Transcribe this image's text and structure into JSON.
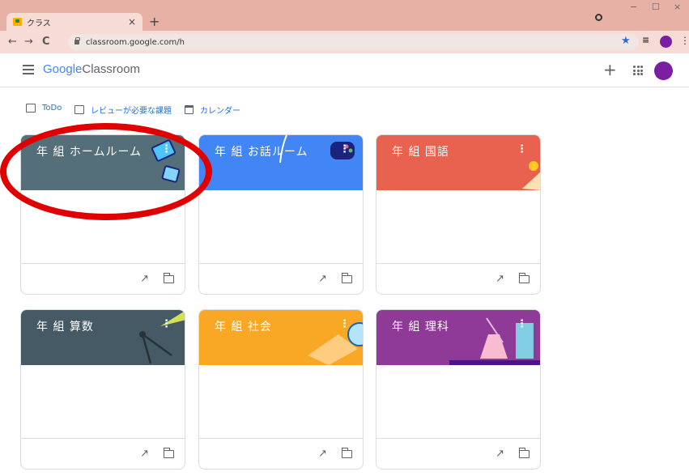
{
  "browser": {
    "tab_title": "クラス",
    "tab_close": "×",
    "new_tab": "+",
    "url": "classroom.google.com/h",
    "window_controls": [
      "−",
      "☐",
      "×"
    ]
  },
  "header": {
    "brand_google": "Google",
    "brand_product": "Classroom",
    "add_symbol": "+"
  },
  "toolbar": {
    "todo": "ToDo",
    "review": "レビューが必要な課題",
    "calendar": "カレンダー"
  },
  "cards": [
    {
      "title": "年 組  ホームルーム",
      "color": "#546e7a"
    },
    {
      "title": "年 組  お話ルーム",
      "color": "#4285f4"
    },
    {
      "title": "年 組  国語",
      "color": "#e8624f"
    },
    {
      "title": "年 組  算数",
      "color": "#455a64"
    },
    {
      "title": "年 組  社会",
      "color": "#f9a825"
    },
    {
      "title": "年 組  理科",
      "color": "#8e3a96"
    }
  ],
  "icons": {
    "card_menu": "⋮",
    "trend": "↗"
  },
  "colors": {
    "annotation": "#e00000",
    "avatar": "#7b1fa2",
    "link": "#1a73e8"
  }
}
